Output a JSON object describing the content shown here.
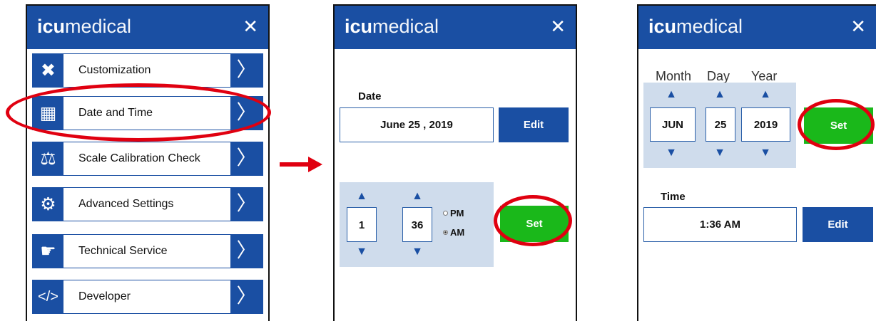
{
  "brand": {
    "bold": "icu",
    "light": "medical"
  },
  "close_glyph": "✕",
  "menu": {
    "items": [
      {
        "label": "Customization",
        "icon": "tools-icon"
      },
      {
        "label": "Date and Time",
        "icon": "calendar-clock-icon"
      },
      {
        "label": "Scale Calibration Check",
        "icon": "scale-icon"
      },
      {
        "label": "Advanced Settings",
        "icon": "gears-icon"
      },
      {
        "label": "Technical Service",
        "icon": "hand-gear-icon"
      },
      {
        "label": "Developer",
        "icon": "code-icon"
      }
    ],
    "arrow_glyph": "〉"
  },
  "flow_arrow_color": "#e00010",
  "panel2": {
    "date_label": "Date",
    "date_value": "June 25 , 2019",
    "edit_label": "Edit",
    "hour": "1",
    "minute": "36",
    "pm_label": "PM",
    "am_label": "AM",
    "selected_period": "AM",
    "set_label": "Set"
  },
  "panel3": {
    "month_label": "Month",
    "day_label": "Day",
    "year_label": "Year",
    "month_value": "JUN",
    "day_value": "25",
    "year_value": "2019",
    "set_label": "Set",
    "time_label": "Time",
    "time_value": "1:36 AM",
    "edit_label": "Edit"
  },
  "colors": {
    "brand_blue": "#1a4fa3",
    "spin_bg": "#cfdcec",
    "set_green": "#1ab81a",
    "highlight_red": "#e00010"
  }
}
